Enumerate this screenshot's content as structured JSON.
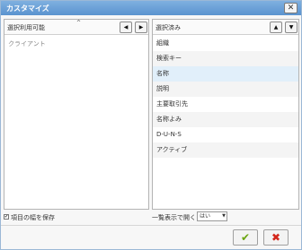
{
  "dialog": {
    "title": "カスタマイズ",
    "close_label": "✕"
  },
  "available": {
    "header": "選択利用可能",
    "sort_caret": "^",
    "left_btn": "◀",
    "right_btn": "▶",
    "items": [
      "クライアント"
    ]
  },
  "selected": {
    "header": "選択済み",
    "up_btn": "▲",
    "down_btn": "▼",
    "items": [
      "組織",
      "検索キー",
      "名称",
      "説明",
      "主要取引先",
      "名称よみ",
      "D-U-N-S",
      "アクティブ"
    ],
    "highlighted_index": 2
  },
  "footer": {
    "save_width_label": "項目の幅を保存",
    "save_width_checked": "✔",
    "open_list_label": "一覧表示で開く",
    "open_list_value": "はい",
    "select_caret": "▼"
  },
  "actions": {
    "ok_label": "✔",
    "cancel_label": "✖"
  }
}
